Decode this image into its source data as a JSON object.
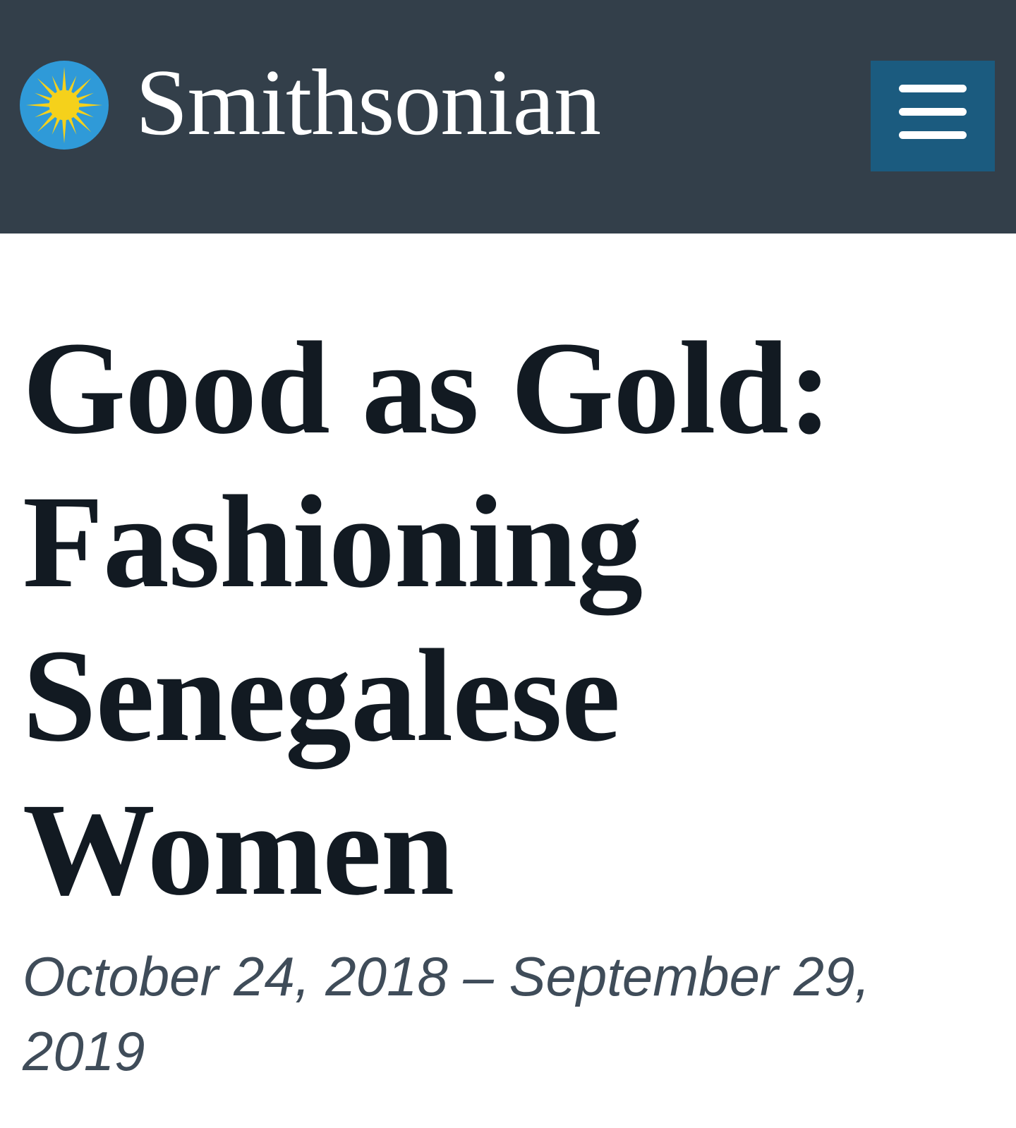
{
  "header": {
    "brand_name": "Smithsonian",
    "logo_icon": "smithsonian-sun-icon",
    "menu_icon": "hamburger-menu-icon",
    "colors": {
      "header_background": "#333f4a",
      "menu_button_background": "#1b5b7f",
      "logo_circle": "#2f9ad8",
      "logo_sun": "#f5d11b"
    }
  },
  "exhibition": {
    "title": "Good as Gold: Fashioning Senegalese Women",
    "dates": "October 24, 2018 – September 29, 2019",
    "colors": {
      "title_text": "#121a22",
      "dates_text": "#3f4c59"
    }
  }
}
